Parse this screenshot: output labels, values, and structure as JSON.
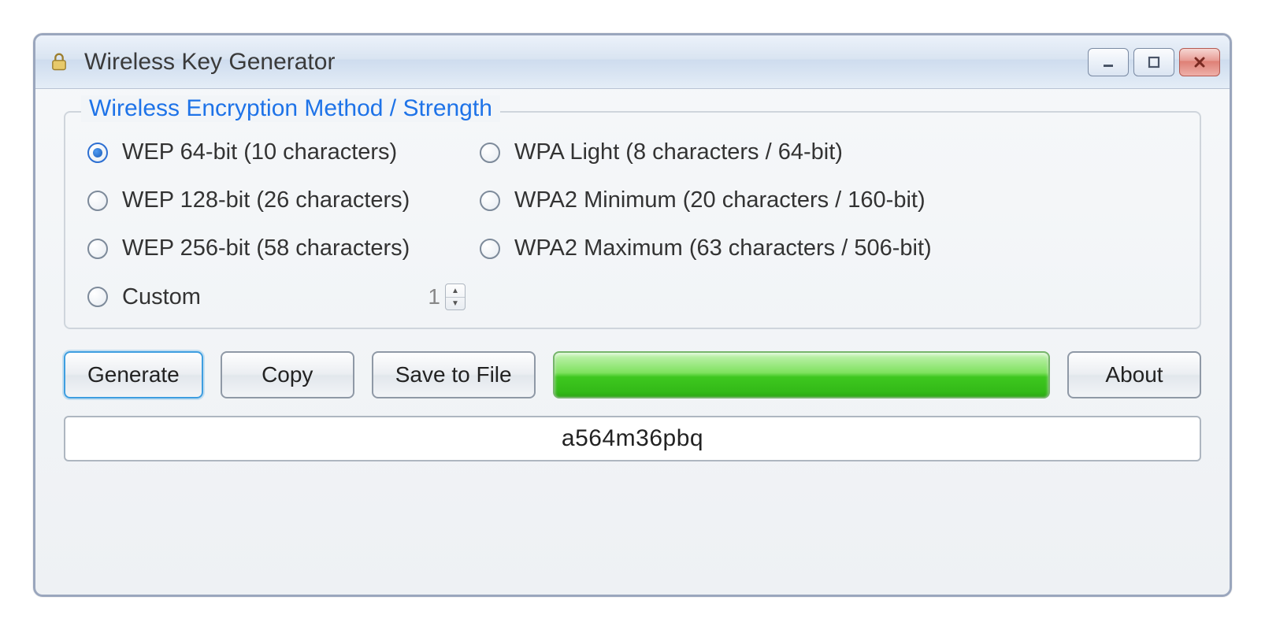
{
  "window": {
    "title": "Wireless Key Generator"
  },
  "group": {
    "legend": "Wireless Encryption Method / Strength",
    "options": {
      "wep64": {
        "label": "WEP 64-bit (10 characters)",
        "checked": true
      },
      "wep128": {
        "label": "WEP 128-bit (26 characters)",
        "checked": false
      },
      "wep256": {
        "label": "WEP 256-bit (58 characters)",
        "checked": false
      },
      "wpal": {
        "label": "WPA Light (8 characters / 64-bit)",
        "checked": false
      },
      "wpa2min": {
        "label": "WPA2 Minimum (20 characters / 160-bit)",
        "checked": false
      },
      "wpa2max": {
        "label": "WPA2 Maximum (63 characters / 506-bit)",
        "checked": false
      },
      "custom": {
        "label": "Custom",
        "checked": false,
        "value": "1"
      }
    }
  },
  "buttons": {
    "generate": "Generate",
    "copy": "Copy",
    "save": "Save to File",
    "about": "About"
  },
  "strength": {
    "percent": 100,
    "color": "#3ec71f"
  },
  "output": {
    "key": "a564m36pbq"
  }
}
